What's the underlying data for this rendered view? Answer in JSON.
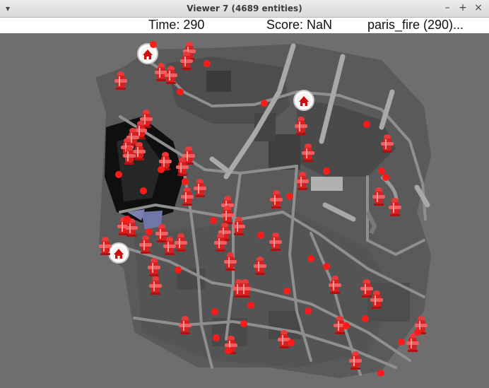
{
  "window": {
    "title": "Viewer 7 (4689 entities)",
    "menu_icon": "chevron-down-icon",
    "controls": {
      "minimize": "–",
      "maximize": "+",
      "close": "×"
    }
  },
  "status": {
    "time": "Time: 290",
    "score": "Score: NaN",
    "scenario": "paris_fire (290)..."
  },
  "colors": {
    "background": "#6e6e6e",
    "road": "#8a8a8a",
    "building": "#4a4a4a",
    "burnt_building": "#111111",
    "water_area": "#6f76a8",
    "agent_dot": "#ff0000",
    "hydrant": "#e01e1e"
  },
  "map_entities": {
    "civilian_markers": "red dots",
    "hydrant_icons": "fire-hydrant-icon",
    "refuge_icons": "house-marker-icon"
  }
}
